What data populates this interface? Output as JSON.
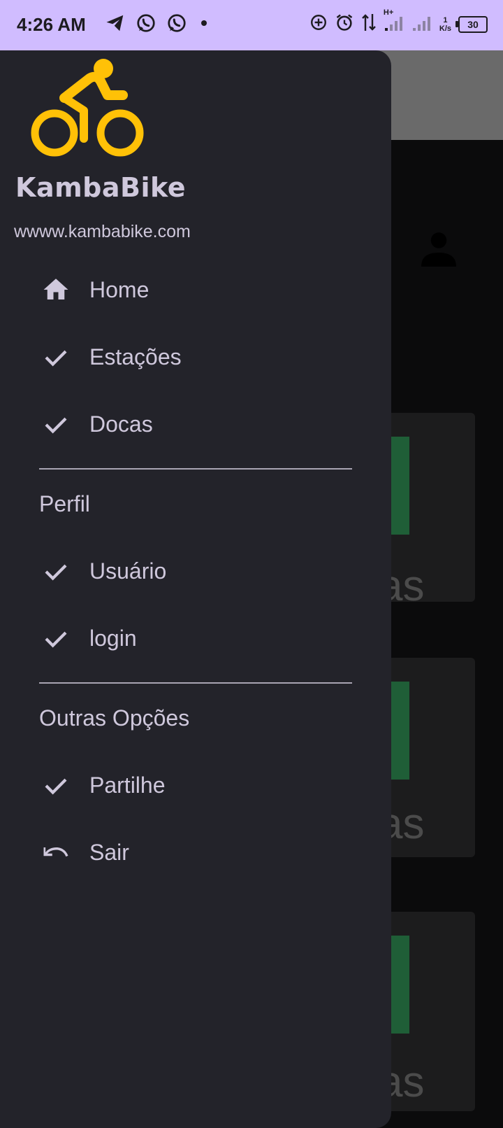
{
  "status_bar": {
    "time": "4:26 AM",
    "left_icons": [
      "telegram-icon",
      "whatsapp-icon",
      "whatsapp-icon",
      "dot-icon"
    ],
    "right_icons": [
      "data-saver-icon",
      "alarm-icon",
      "data-arrows-icon",
      "signal-icon",
      "signal-icon"
    ],
    "network_type": "H+",
    "net_speed_value": "1",
    "net_speed_unit": "K/s",
    "battery": "30"
  },
  "drawer": {
    "brand": "KambaBike",
    "website": "wwww.kambabike.com",
    "main_items": [
      {
        "label": "Home",
        "icon": "home-icon"
      },
      {
        "label": "Estações",
        "icon": "check-icon"
      },
      {
        "label": "Docas",
        "icon": "check-icon"
      }
    ],
    "sections": [
      {
        "title": "Perfil",
        "items": [
          {
            "label": "Usuário",
            "icon": "check-icon"
          },
          {
            "label": "login",
            "icon": "check-icon"
          }
        ]
      },
      {
        "title": "Outras Opções",
        "items": [
          {
            "label": "Partilhe",
            "icon": "check-icon"
          },
          {
            "label": "Sair",
            "icon": "undo-icon"
          }
        ]
      }
    ]
  },
  "background": {
    "card_text": "as"
  },
  "colors": {
    "status_bar": "#d0bcff",
    "drawer": "#23232a",
    "logo": "#ffc107",
    "text": "#cfc8dc"
  }
}
